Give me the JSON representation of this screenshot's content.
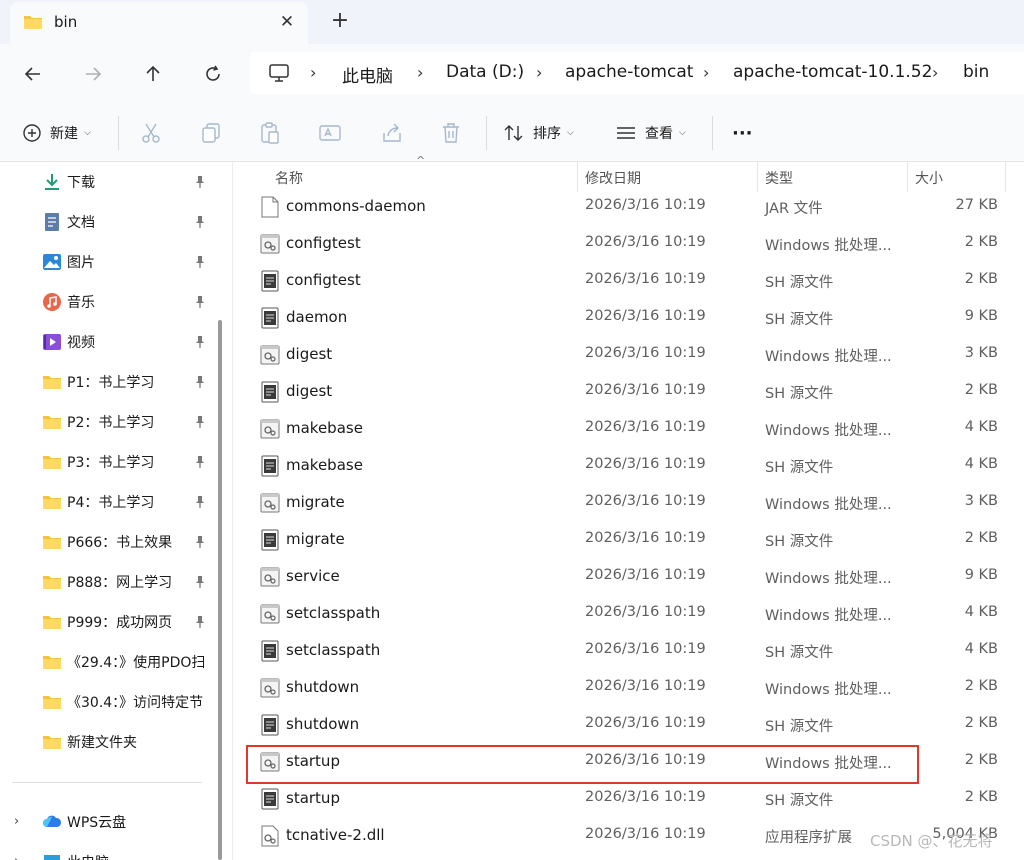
{
  "tab": {
    "title": "bin",
    "close": "✕",
    "add": "+"
  },
  "nav": {
    "back": "back",
    "forward": "forward",
    "up": "up",
    "refresh": "refresh",
    "breadcrumb": [
      "此电脑",
      "Data (D:)",
      "apache-tomcat",
      "apache-tomcat-10.1.52",
      "bin"
    ],
    "sep": "›"
  },
  "toolbar": {
    "new_label": "新建",
    "sort_label": "排序",
    "view_label": "查看",
    "more_label": "···"
  },
  "sidebar": {
    "items": [
      {
        "label": "下载",
        "icon": "download-icon",
        "pinned": true
      },
      {
        "label": "文档",
        "icon": "document-icon",
        "pinned": true
      },
      {
        "label": "图片",
        "icon": "picture-icon",
        "pinned": true
      },
      {
        "label": "音乐",
        "icon": "music-icon",
        "pinned": true
      },
      {
        "label": "视频",
        "icon": "video-icon",
        "pinned": true
      },
      {
        "label": "P1：书上学习",
        "icon": "folder-icon",
        "pinned": true
      },
      {
        "label": "P2：书上学习",
        "icon": "folder-icon",
        "pinned": true
      },
      {
        "label": "P3：书上学习",
        "icon": "folder-icon",
        "pinned": true
      },
      {
        "label": "P4：书上学习",
        "icon": "folder-icon",
        "pinned": true
      },
      {
        "label": "P666：书上效果",
        "icon": "folder-icon",
        "pinned": true
      },
      {
        "label": "P888：网上学习",
        "icon": "folder-icon",
        "pinned": true
      },
      {
        "label": "P999：成功网页",
        "icon": "folder-icon",
        "pinned": true
      },
      {
        "label": "《29.4：》使用PDO扫",
        "icon": "folder-icon",
        "pinned": false
      },
      {
        "label": "《30.4：》访问特定节",
        "icon": "folder-icon",
        "pinned": false
      },
      {
        "label": "新建文件夹",
        "icon": "folder-icon",
        "pinned": false
      }
    ],
    "wps": "WPS云盘",
    "pc": "此电脑"
  },
  "columns": {
    "name": "名称",
    "date": "修改日期",
    "type": "类型",
    "size": "大小"
  },
  "files": [
    {
      "name": "commons-daemon",
      "date": "2026/3/16 10:19",
      "type": "JAR 文件",
      "size": "27 KB",
      "icon": "jar-file-icon"
    },
    {
      "name": "configtest",
      "date": "2026/3/16 10:19",
      "type": "Windows 批处理...",
      "size": "2 KB",
      "icon": "batch-file-icon"
    },
    {
      "name": "configtest",
      "date": "2026/3/16 10:19",
      "type": "SH 源文件",
      "size": "2 KB",
      "icon": "sh-file-icon"
    },
    {
      "name": "daemon",
      "date": "2026/3/16 10:19",
      "type": "SH 源文件",
      "size": "9 KB",
      "icon": "sh-file-icon"
    },
    {
      "name": "digest",
      "date": "2026/3/16 10:19",
      "type": "Windows 批处理...",
      "size": "3 KB",
      "icon": "batch-file-icon"
    },
    {
      "name": "digest",
      "date": "2026/3/16 10:19",
      "type": "SH 源文件",
      "size": "2 KB",
      "icon": "sh-file-icon"
    },
    {
      "name": "makebase",
      "date": "2026/3/16 10:19",
      "type": "Windows 批处理...",
      "size": "4 KB",
      "icon": "batch-file-icon"
    },
    {
      "name": "makebase",
      "date": "2026/3/16 10:19",
      "type": "SH 源文件",
      "size": "4 KB",
      "icon": "sh-file-icon"
    },
    {
      "name": "migrate",
      "date": "2026/3/16 10:19",
      "type": "Windows 批处理...",
      "size": "3 KB",
      "icon": "batch-file-icon"
    },
    {
      "name": "migrate",
      "date": "2026/3/16 10:19",
      "type": "SH 源文件",
      "size": "2 KB",
      "icon": "sh-file-icon"
    },
    {
      "name": "service",
      "date": "2026/3/16 10:19",
      "type": "Windows 批处理...",
      "size": "9 KB",
      "icon": "batch-file-icon"
    },
    {
      "name": "setclasspath",
      "date": "2026/3/16 10:19",
      "type": "Windows 批处理...",
      "size": "4 KB",
      "icon": "batch-file-icon"
    },
    {
      "name": "setclasspath",
      "date": "2026/3/16 10:19",
      "type": "SH 源文件",
      "size": "4 KB",
      "icon": "sh-file-icon"
    },
    {
      "name": "shutdown",
      "date": "2026/3/16 10:19",
      "type": "Windows 批处理...",
      "size": "2 KB",
      "icon": "batch-file-icon"
    },
    {
      "name": "shutdown",
      "date": "2026/3/16 10:19",
      "type": "SH 源文件",
      "size": "2 KB",
      "icon": "sh-file-icon"
    },
    {
      "name": "startup",
      "date": "2026/3/16 10:19",
      "type": "Windows 批处理...",
      "size": "2 KB",
      "icon": "batch-file-icon"
    },
    {
      "name": "startup",
      "date": "2026/3/16 10:19",
      "type": "SH 源文件",
      "size": "2 KB",
      "icon": "sh-file-icon"
    },
    {
      "name": "tcnative-2.dll",
      "date": "2026/3/16 10:19",
      "type": "应用程序扩展",
      "size": "5,004 KB",
      "icon": "dll-file-icon"
    }
  ],
  "watermark": "CSDN @、花无将",
  "colors": {
    "highlight": "#e0392b",
    "folder": "#f5c342",
    "accent": "#0067c0"
  }
}
